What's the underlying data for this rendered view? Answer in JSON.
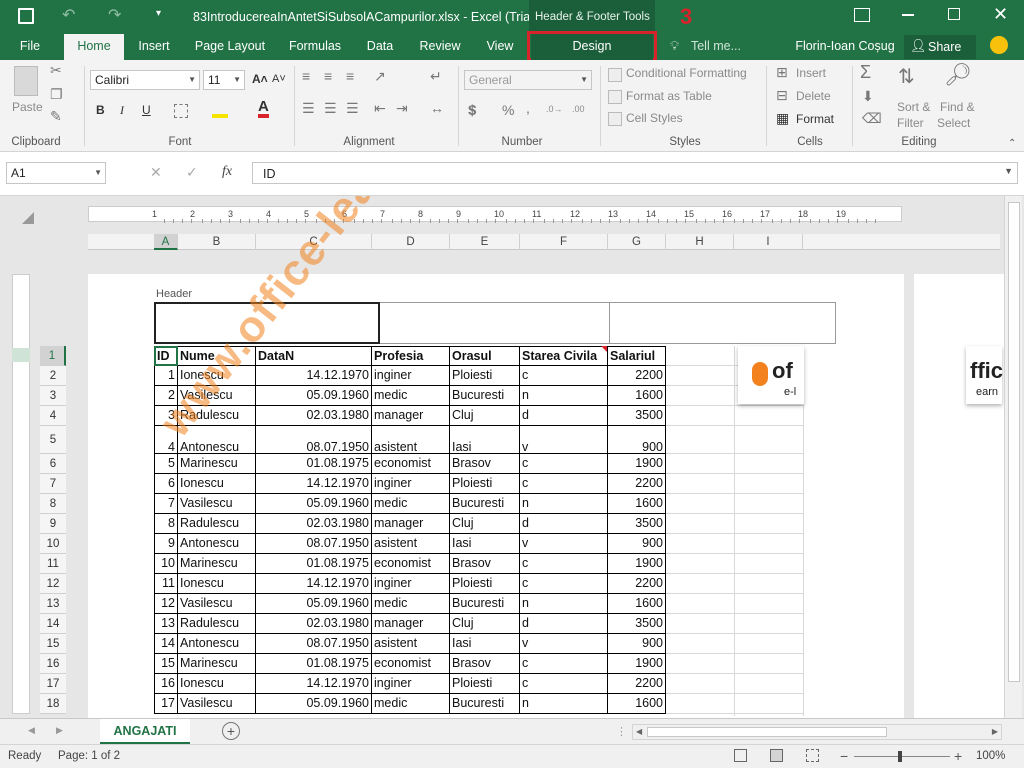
{
  "title_bar": {
    "file_name": "83IntroducereaInAntetSiSubsolACampurilor.xlsx - Excel (Trial)",
    "context_tab_group": "Header & Footer Tools"
  },
  "annotation": {
    "number": "3"
  },
  "tabs": {
    "file": "File",
    "home": "Home",
    "insert": "Insert",
    "page_layout": "Page Layout",
    "formulas": "Formulas",
    "data": "Data",
    "review": "Review",
    "view": "View",
    "design": "Design",
    "tell_me": "Tell me...",
    "user": "Florin-Ioan Coșug",
    "share": "Share"
  },
  "ribbon": {
    "clipboard": {
      "paste": "Paste",
      "label": "Clipboard"
    },
    "font": {
      "name": "Calibri",
      "size": "11",
      "label": "Font",
      "bold": "B",
      "italic": "I",
      "underline": "U"
    },
    "alignment": {
      "label": "Alignment"
    },
    "number": {
      "format": "General",
      "label": "Number"
    },
    "styles": {
      "conditional": "Conditional Formatting",
      "format_table": "Format as Table",
      "cell_styles": "Cell Styles",
      "label": "Styles"
    },
    "cells": {
      "insert": "Insert",
      "delete": "Delete",
      "format": "Format",
      "label": "Cells"
    },
    "editing": {
      "sort": "Sort &",
      "filter": "Filter",
      "find": "Find &",
      "select": "Select",
      "label": "Editing"
    }
  },
  "formula_bar": {
    "name_box": "A1",
    "fx": "fx",
    "content": "ID"
  },
  "columns": [
    "A",
    "B",
    "C",
    "D",
    "E",
    "F",
    "G",
    "H",
    "I"
  ],
  "ruler_numbers": [
    "1",
    "2",
    "3",
    "4",
    "5",
    "6",
    "7",
    "8",
    "9",
    "10",
    "11",
    "12",
    "13",
    "14",
    "15",
    "16",
    "17",
    "18",
    "19"
  ],
  "header_label": "Header",
  "table": {
    "headers": [
      "ID",
      "Nume",
      "DataN",
      "Profesia",
      "Orasul",
      "Starea Civila",
      "Salariul"
    ],
    "rows": [
      [
        "1",
        "Ionescu",
        "14.12.1970",
        "inginer",
        "Ploiesti",
        "c",
        "2200"
      ],
      [
        "2",
        "Vasilescu",
        "05.09.1960",
        "medic",
        "Bucuresti",
        "n",
        "1600"
      ],
      [
        "3",
        "Radulescu",
        "02.03.1980",
        "manager",
        "Cluj",
        "d",
        "3500"
      ],
      [
        "4",
        "Antonescu",
        "08.07.1950",
        "asistent",
        "Iasi",
        "v",
        "900"
      ],
      [
        "5",
        "Marinescu",
        "01.08.1975",
        "economist",
        "Brasov",
        "c",
        "1900"
      ],
      [
        "6",
        "Ionescu",
        "14.12.1970",
        "inginer",
        "Ploiesti",
        "c",
        "2200"
      ],
      [
        "7",
        "Vasilescu",
        "05.09.1960",
        "medic",
        "Bucuresti",
        "n",
        "1600"
      ],
      [
        "8",
        "Radulescu",
        "02.03.1980",
        "manager",
        "Cluj",
        "d",
        "3500"
      ],
      [
        "9",
        "Antonescu",
        "08.07.1950",
        "asistent",
        "Iasi",
        "v",
        "900"
      ],
      [
        "10",
        "Marinescu",
        "01.08.1975",
        "economist",
        "Brasov",
        "c",
        "1900"
      ],
      [
        "11",
        "Ionescu",
        "14.12.1970",
        "inginer",
        "Ploiesti",
        "c",
        "2200"
      ],
      [
        "12",
        "Vasilescu",
        "05.09.1960",
        "medic",
        "Bucuresti",
        "n",
        "1600"
      ],
      [
        "13",
        "Radulescu",
        "02.03.1980",
        "manager",
        "Cluj",
        "d",
        "3500"
      ],
      [
        "14",
        "Antonescu",
        "08.07.1950",
        "asistent",
        "Iasi",
        "v",
        "900"
      ],
      [
        "15",
        "Marinescu",
        "01.08.1975",
        "economist",
        "Brasov",
        "c",
        "1900"
      ],
      [
        "16",
        "Ionescu",
        "14.12.1970",
        "inginer",
        "Ploiesti",
        "c",
        "2200"
      ],
      [
        "17",
        "Vasilescu",
        "05.09.1960",
        "medic",
        "Bucuresti",
        "n",
        "1600"
      ]
    ],
    "row_numbers": [
      "1",
      "2",
      "3",
      "4",
      "5",
      "6",
      "7",
      "8",
      "9",
      "10",
      "11",
      "12",
      "13",
      "14",
      "15",
      "16",
      "17",
      "18"
    ]
  },
  "watermark": "www.office-learning.ro",
  "logo": {
    "text": "of",
    "text2": "ffic",
    "sub": "e-l",
    "sub2": "earn"
  },
  "sheet_tab": "ANGAJATI",
  "status": {
    "ready": "Ready",
    "page": "Page: 1 of 2",
    "zoom": "100%"
  },
  "colors": {
    "excel_green": "#217346",
    "highlight_red": "#d9232a",
    "watermark_orange": "#f3821e"
  }
}
